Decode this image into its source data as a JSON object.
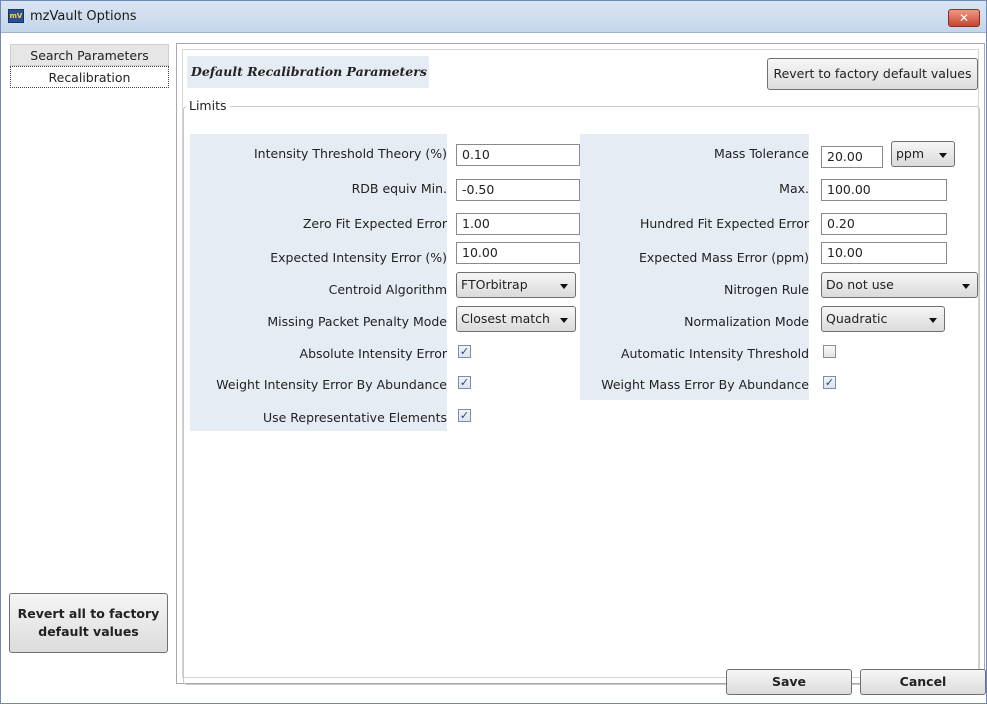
{
  "window": {
    "title": "mzVault Options",
    "app_icon_text": "mV",
    "close_glyph": "✕"
  },
  "sidebar": {
    "items": [
      {
        "label": "Search Parameters"
      },
      {
        "label": "Recalibration"
      }
    ],
    "revert_all_line1": "Revert all to factory",
    "revert_all_line2": "default values"
  },
  "panel": {
    "section_title": "Default Recalibration Parameters",
    "revert_factory_label": "Revert to factory default values",
    "limits_legend": "Limits"
  },
  "left_fields": {
    "intensity_threshold_theory": {
      "label": "Intensity Threshold Theory (%)",
      "value": "0.10"
    },
    "rdb_equiv_min": {
      "label": "RDB equiv Min.",
      "value": "-0.50"
    },
    "zero_fit_expected_error": {
      "label": "Zero Fit Expected Error",
      "value": "1.00"
    },
    "expected_intensity_error": {
      "label": "Expected Intensity Error (%)",
      "value": "10.00"
    },
    "centroid_algorithm": {
      "label": "Centroid Algorithm",
      "value": "FTOrbitrap"
    },
    "missing_packet_penalty_mode": {
      "label": "Missing Packet Penalty Mode",
      "value": "Closest match"
    },
    "absolute_intensity_error": {
      "label": "Absolute Intensity Error",
      "checked": true
    },
    "weight_intensity_error_by_abundance": {
      "label": "Weight Intensity Error By Abundance",
      "checked": true
    },
    "use_representative_elements": {
      "label": "Use Representative Elements",
      "checked": true
    }
  },
  "right_fields": {
    "mass_tolerance": {
      "label": "Mass Tolerance",
      "value": "20.00",
      "unit": "ppm"
    },
    "max": {
      "label": "Max.",
      "value": "100.00"
    },
    "hundred_fit_expected_error": {
      "label": "Hundred Fit Expected Error",
      "value": "0.20"
    },
    "expected_mass_error": {
      "label": "Expected Mass Error (ppm)",
      "value": "10.00"
    },
    "nitrogen_rule": {
      "label": "Nitrogen Rule",
      "value": "Do not use"
    },
    "normalization_mode": {
      "label": "Normalization Mode",
      "value": "Quadratic"
    },
    "automatic_intensity_threshold": {
      "label": "Automatic Intensity Threshold",
      "checked": false
    },
    "weight_mass_error_by_abundance": {
      "label": "Weight Mass Error By Abundance",
      "checked": true
    }
  },
  "checkbox_glyph": "✓",
  "footer": {
    "save_label": "Save",
    "cancel_label": "Cancel"
  }
}
